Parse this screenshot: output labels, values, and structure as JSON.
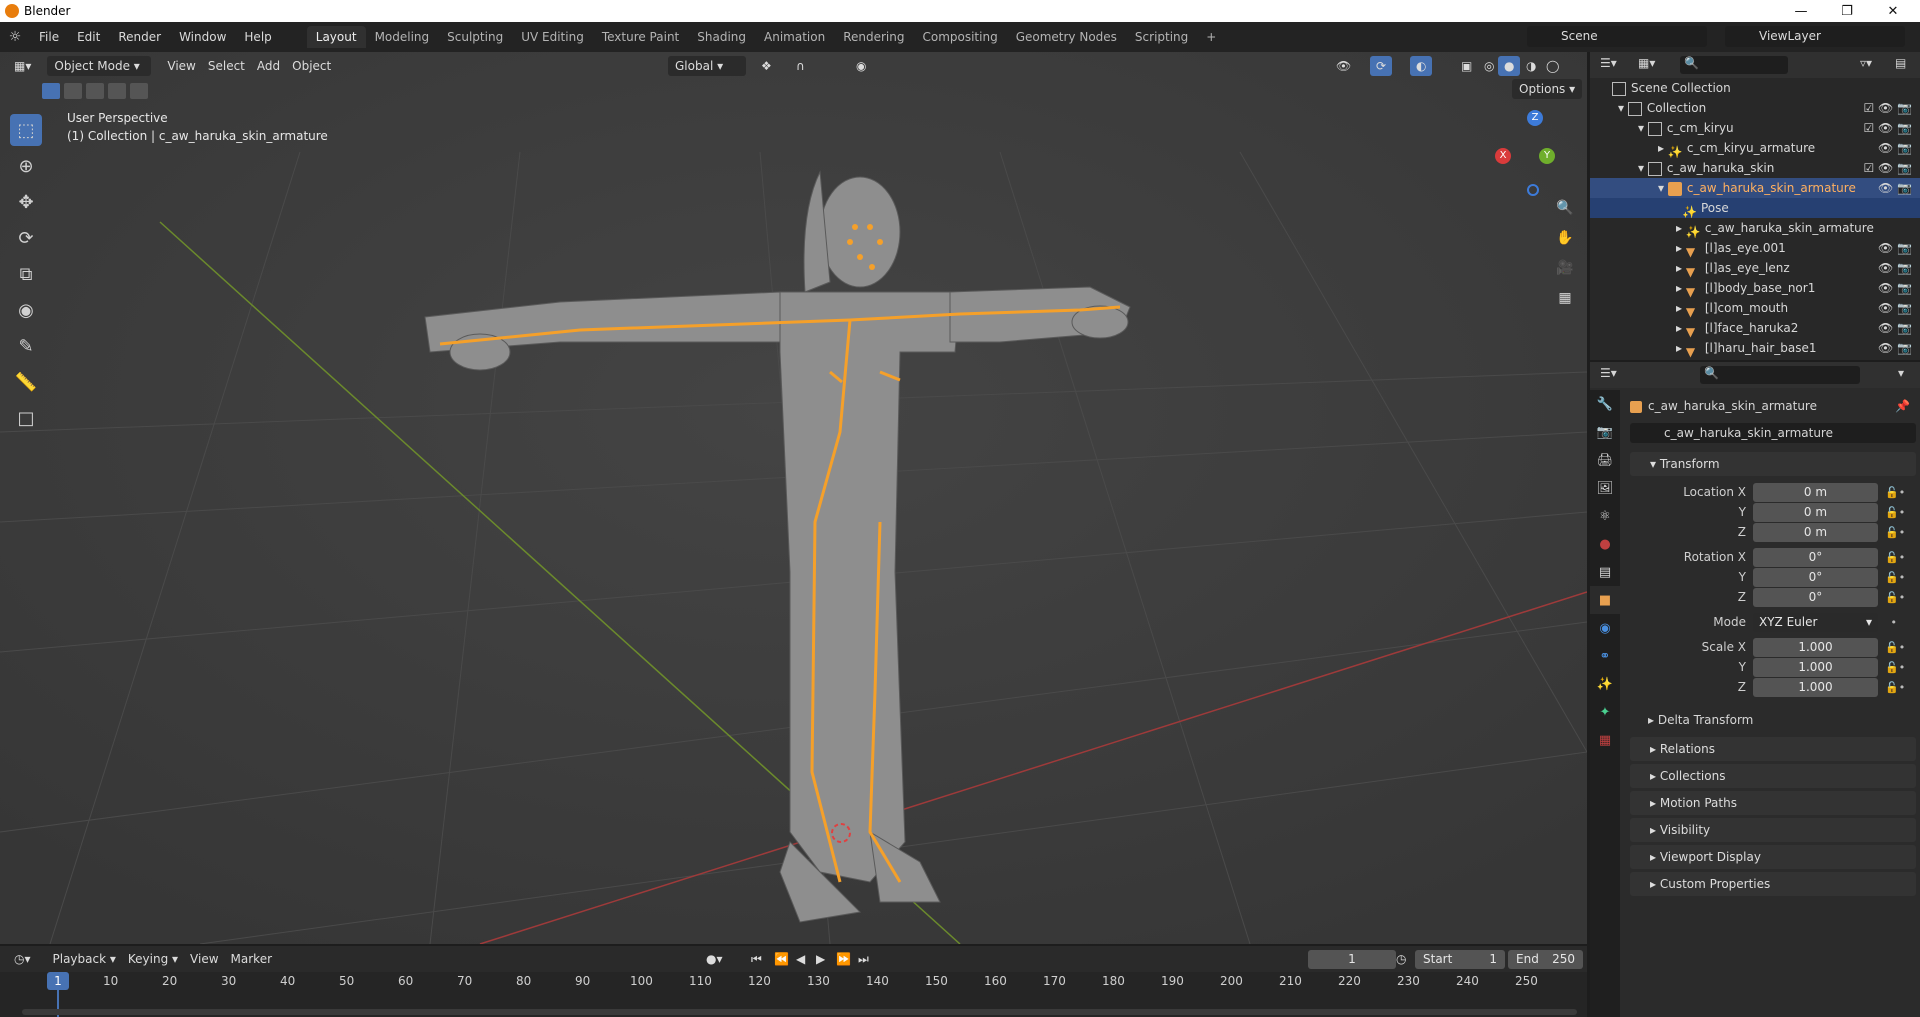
{
  "app": {
    "title": "Blender"
  },
  "menu": {
    "file": "File",
    "edit": "Edit",
    "render": "Render",
    "window": "Window",
    "help": "Help"
  },
  "workspaces": [
    "Layout",
    "Modeling",
    "Sculpting",
    "UV Editing",
    "Texture Paint",
    "Shading",
    "Animation",
    "Rendering",
    "Compositing",
    "Geometry Nodes",
    "Scripting",
    "+"
  ],
  "scene": {
    "name": "Scene",
    "view_layer": "ViewLayer"
  },
  "viewport": {
    "mode": "Object Mode",
    "view": "View",
    "select": "Select",
    "add": "Add",
    "object": "Object",
    "orientation": "Global",
    "options": "Options",
    "overlay_title": "User Perspective",
    "overlay_sub": "(1) Collection | c_aw_haruka_skin_armature",
    "gizmo": {
      "x": "X",
      "y": "Y",
      "z": "Z"
    }
  },
  "outliner": {
    "rows": [
      {
        "label": "Scene Collection"
      },
      {
        "label": "Collection"
      },
      {
        "label": "c_cm_kiryu"
      },
      {
        "label": "c_cm_kiryu_armature"
      },
      {
        "label": "c_aw_haruka_skin"
      },
      {
        "label": "c_aw_haruka_skin_armature"
      },
      {
        "label": "Pose"
      },
      {
        "label": "c_aw_haruka_skin_armature"
      },
      {
        "label": "[l]as_eye.001"
      },
      {
        "label": "[l]as_eye_lenz"
      },
      {
        "label": "[l]body_base_nor1"
      },
      {
        "label": "[l]com_mouth"
      },
      {
        "label": "[l]face_haruka2"
      },
      {
        "label": "[l]haru_hair_base1"
      }
    ]
  },
  "properties": {
    "object_name": "c_aw_haruka_skin_armature",
    "data_name": "c_aw_haruka_skin_armature",
    "transform": "Transform",
    "location_label": "Location X",
    "rotation_label": "Rotation X",
    "scale_label": "Scale X",
    "y": "Y",
    "z": "Z",
    "location": [
      "0 m",
      "0 m",
      "0 m"
    ],
    "rotation": [
      "0°",
      "0°",
      "0°"
    ],
    "mode_label": "Mode",
    "mode": "XYZ Euler",
    "scale": [
      "1.000",
      "1.000",
      "1.000"
    ],
    "delta": "Delta Transform",
    "panels": [
      "Relations",
      "Collections",
      "Motion Paths",
      "Visibility",
      "Viewport Display",
      "Custom Properties"
    ]
  },
  "timeline": {
    "playback": "Playback",
    "keying": "Keying",
    "view": "View",
    "marker": "Marker",
    "current_frame": "1",
    "start_label": "Start",
    "start": "1",
    "end_label": "End",
    "end": "250",
    "ticks": [
      "1",
      "10",
      "20",
      "30",
      "40",
      "50",
      "60",
      "70",
      "80",
      "90",
      "100",
      "110",
      "120",
      "130",
      "140",
      "150",
      "160",
      "170",
      "180",
      "190",
      "200",
      "210",
      "220",
      "230",
      "240",
      "250"
    ]
  }
}
